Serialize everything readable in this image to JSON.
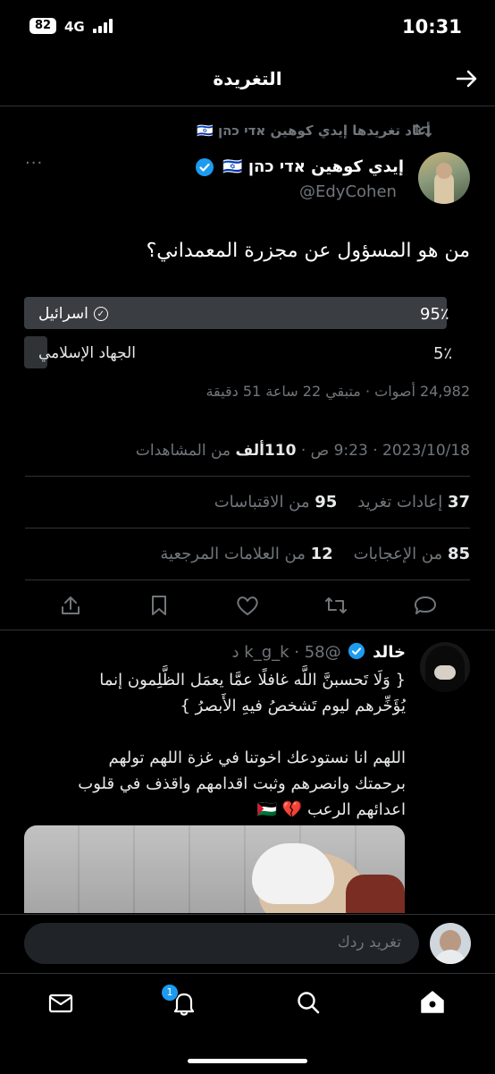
{
  "status_bar": {
    "time": "10:31",
    "battery": "82",
    "network": "4G"
  },
  "header": {
    "title": "التغريدة"
  },
  "retweet": {
    "label": "أعاد تغريدها إيدي كوهين אדי כהן 🇮🇱"
  },
  "author": {
    "name": "إيدي كوهين אדי כהן 🇮🇱",
    "handle": "@EdyCohen"
  },
  "tweet": {
    "text": "من هو المسؤول عن مجزرة المعمداني؟"
  },
  "poll": {
    "options": [
      {
        "label": "اسرائيل",
        "percent_label": "95٪",
        "percent": 95,
        "winner": true
      },
      {
        "label": "الجهاد الإسلامي",
        "percent_label": "5٪",
        "percent": 5,
        "winner": false
      }
    ],
    "summary": "24,982 أصوات · متبقي 22 ساعة 51 دقيقة"
  },
  "meta": {
    "time": "9:23 ص",
    "date": "2023/10/18",
    "views_count": "110ألف",
    "views_label": "من المشاهدات"
  },
  "stats": {
    "retweets_count": "37",
    "retweets_label": "إعادات تغريد",
    "quotes_count": "95",
    "quotes_label": "من الاقتباسات",
    "likes_count": "85",
    "likes_label": "من الإعجابات",
    "bookmarks_count": "12",
    "bookmarks_label": "من العلامات المرجعية"
  },
  "reply": {
    "name": "خالد",
    "handle": "@k_g_k",
    "age": "58 د",
    "line1": "{ وَلَا تَحسبنَّ اللَّه غافلًا عمَّا يعمَل الظَّلِمون إنما",
    "line2": "يُؤَخِّرهم ليوم تَشخصُ فيهِ الأَبصرُ }",
    "line3": "اللهم انا نستودعك اخوتنا في غزة اللهم تولهم",
    "line4": "برحمتك وانصرهم وثبت اقدامهم واقذف في قلوب",
    "line5": "اعدائهم الرعب 💔 🇵🇸"
  },
  "composer": {
    "placeholder": "تغريد ردك"
  },
  "tabbar": {
    "notifications_badge": "1"
  },
  "colors": {
    "accent": "#1d9bf0",
    "background": "#000000",
    "muted": "#71767b",
    "verified": "#1d9bf0"
  }
}
